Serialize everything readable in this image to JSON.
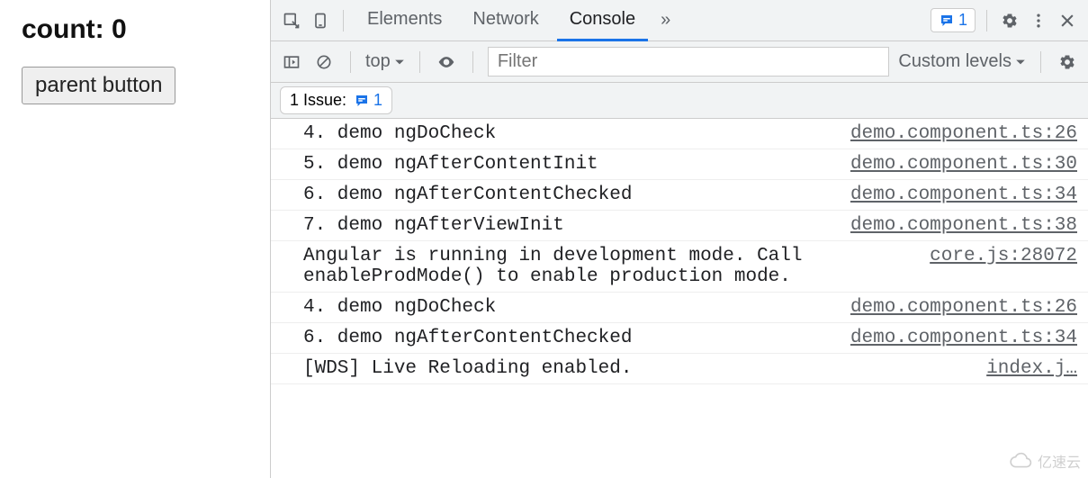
{
  "page": {
    "count_label": "count: 0",
    "button_label": "parent button"
  },
  "devtools": {
    "tabs": {
      "elements": "Elements",
      "network": "Network",
      "console": "Console",
      "overflow": "»"
    },
    "issue_count": "1",
    "toolbar": {
      "context_label": "top",
      "filter_placeholder": "Filter",
      "levels_label": "Custom levels"
    },
    "issues_bar": {
      "label": "1 Issue:",
      "count": "1"
    },
    "console_rows": [
      {
        "msg": "4. demo ngDoCheck",
        "src": "demo.component.ts:26"
      },
      {
        "msg": "5. demo ngAfterContentInit",
        "src": "demo.component.ts:30"
      },
      {
        "msg": "6. demo ngAfterContentChecked",
        "src": "demo.component.ts:34"
      },
      {
        "msg": "7. demo ngAfterViewInit",
        "src": "demo.component.ts:38"
      },
      {
        "msg": "Angular is running in development mode. Call enableProdMode() to enable production mode.",
        "src": "core.js:28072"
      },
      {
        "msg": "4. demo ngDoCheck",
        "src": "demo.component.ts:26"
      },
      {
        "msg": "6. demo ngAfterContentChecked",
        "src": "demo.component.ts:34"
      },
      {
        "msg": "[WDS] Live Reloading enabled.",
        "src": "index.j…"
      }
    ]
  },
  "watermark": {
    "text": "亿速云"
  }
}
